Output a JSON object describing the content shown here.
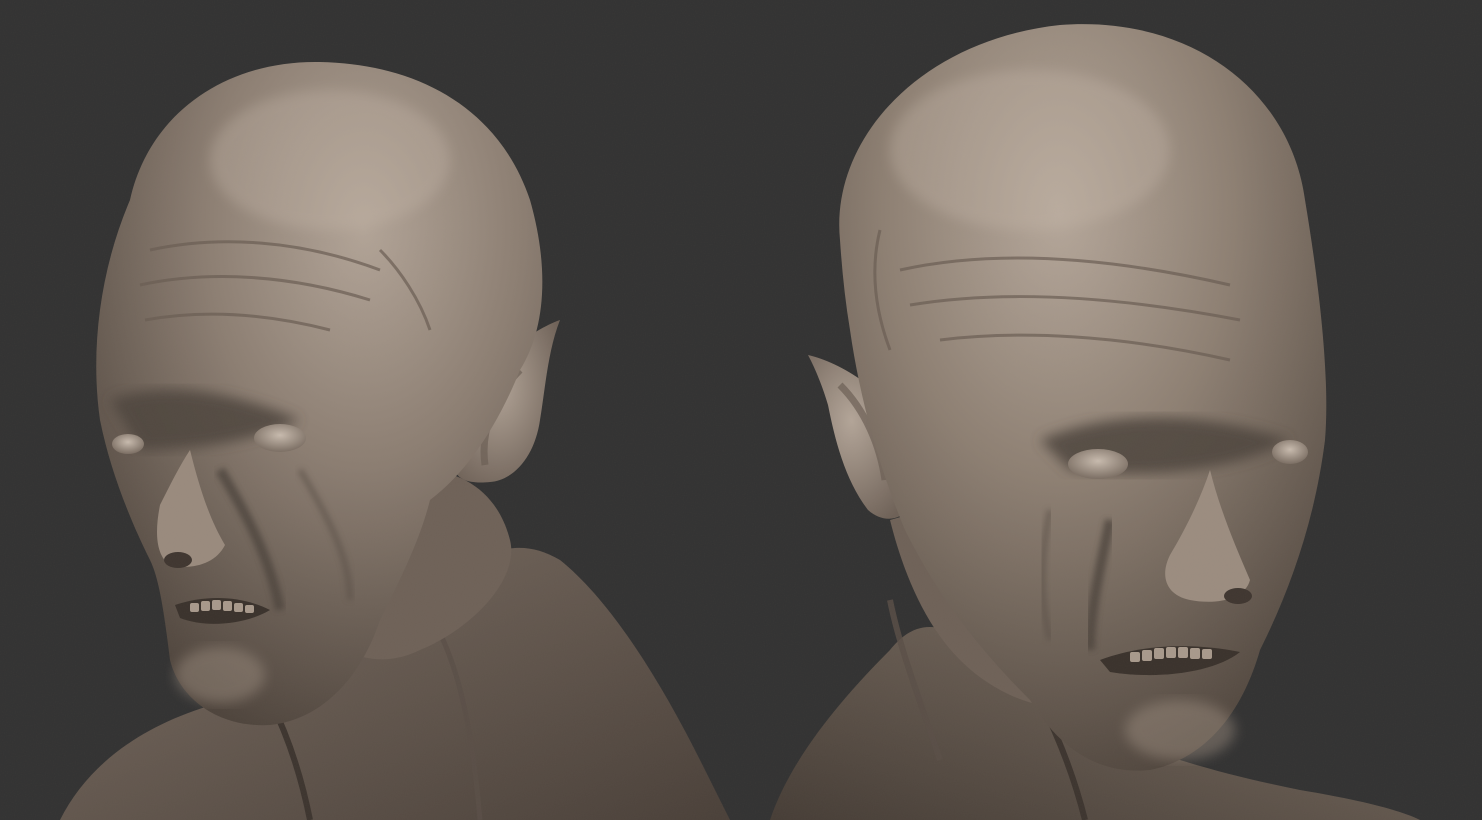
{
  "scene": {
    "description_free": true,
    "background_color": "#323232",
    "clay_base_color": "#8a7c70",
    "clay_light_color": "#b3a598",
    "clay_shadow_color": "#4a4039",
    "clay_deep_shadow_color": "#2c2622"
  },
  "views": [
    {
      "id": "left-bust",
      "facing": "three-quarter-left",
      "subject": "bald-creature-bust"
    },
    {
      "id": "right-bust",
      "facing": "three-quarter-right",
      "subject": "bald-creature-bust"
    }
  ]
}
